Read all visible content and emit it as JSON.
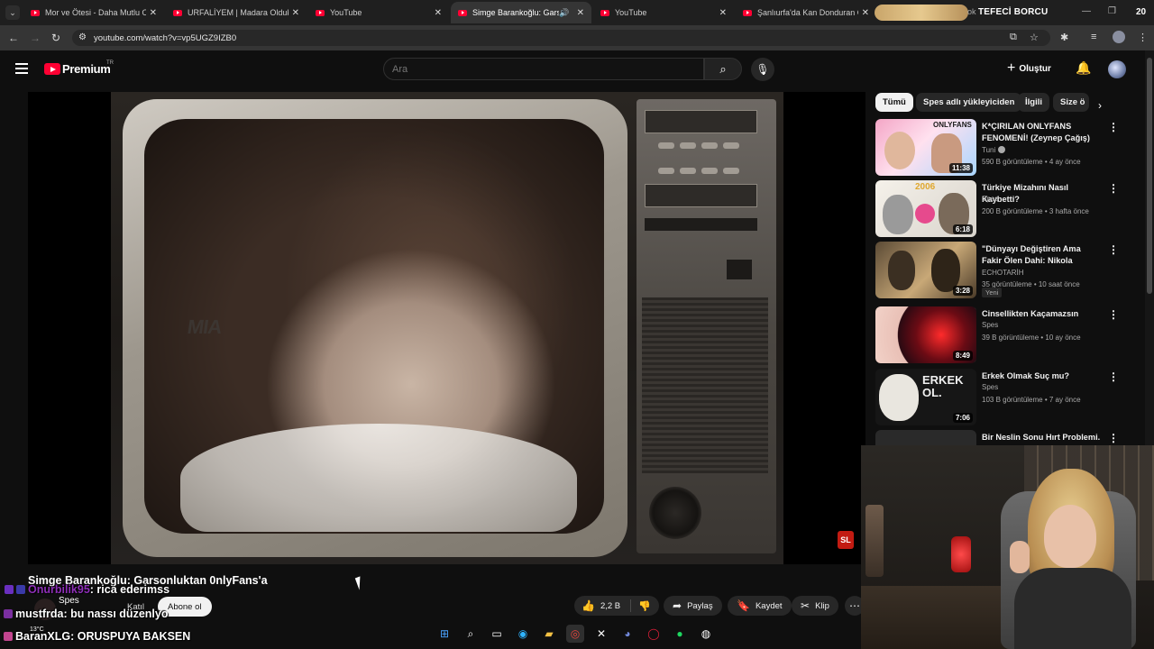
{
  "tabs": [
    {
      "title": "Mor ve Ötesi - Daha Mutlu Ola",
      "active": false
    },
    {
      "title": "URFALİYEM | Madara Olduk #6",
      "active": false
    },
    {
      "title": "YouTube",
      "active": false
    },
    {
      "title": "Simge Barankoğlu: Garsonl",
      "active": true
    },
    {
      "title": "YouTube",
      "active": false
    },
    {
      "title": "Şanlıurfa'da Kan Donduran Ola",
      "active": false
    }
  ],
  "overlay": {
    "title": "TEFECİ BORCU",
    "tab_fragment": "ok",
    "number": "20"
  },
  "address_bar": {
    "url": "youtube.com/watch?v=vp5UGZ9IZB0"
  },
  "masthead": {
    "brand": "Premium",
    "region": "TR",
    "search_placeholder": "Ara",
    "create_label": "Oluştur"
  },
  "video": {
    "title": "Simge Barankoğlu: Garsonluktan 0nlyFans'a",
    "channel": "Spes",
    "join_label": "Katıl",
    "subscribe_label": "Abone ol",
    "sign_text": "MIA"
  },
  "actions": {
    "likes": "2,2 B",
    "share": "Paylaş",
    "save": "Kaydet",
    "clip": "Klip"
  },
  "chat": [
    {
      "user": "Onurbilik95",
      "message": ": rica ederimss"
    },
    {
      "user": "mustfrda",
      "message": ": bu nassı düzenlyo"
    },
    {
      "user": "BaranXLG",
      "message": ": ORUSPUYA BAKSEN"
    }
  ],
  "weather": {
    "temp": "13°C"
  },
  "chips": [
    "Tümü",
    "Spes adlı yükleyiciden",
    "İlgili",
    "Size ö"
  ],
  "recommendations": [
    {
      "title": "K*ÇIRILAN ONLYFANS FENOMENİ! (Zeynep Çağış)",
      "channel": "Tuni",
      "verified": true,
      "meta": "590 B görüntüleme • 4 ay önce",
      "duration": "11:38",
      "badge": ""
    },
    {
      "title": "Türkiye Mizahını Nasıl Kaybetti?",
      "channel": "Spes",
      "verified": false,
      "meta": "200 B görüntüleme • 3 hafta önce",
      "duration": "6:18",
      "badge": ""
    },
    {
      "title": "\"Dünyayı Değiştiren Ama Fakir Ölen Dahi: Nikola Tesla'nın ...",
      "channel": "ECHOTARİH",
      "verified": false,
      "meta": "35 görüntüleme • 10 saat önce",
      "duration": "3:28",
      "badge": "Yeni"
    },
    {
      "title": "Cinsellikten Kaçamazsın",
      "channel": "Spes",
      "verified": false,
      "meta": "39 B görüntüleme • 10 ay önce",
      "duration": "8:49",
      "badge": ""
    },
    {
      "title": "Erkek Olmak Suç mu?",
      "channel": "Spes",
      "verified": false,
      "meta": "103 B görüntüleme • 7 ay önce",
      "duration": "7:06",
      "badge": ""
    },
    {
      "title": "Bir Neslin Sonu Hırt Problemi.",
      "channel": "",
      "verified": false,
      "meta": "",
      "duration": "",
      "badge": ""
    }
  ],
  "thumb_texts": [
    "ONLYFANS",
    "2006",
    "",
    "",
    "ERKEK OL.",
    ""
  ],
  "colors": {
    "youtube_red": "#ff0033",
    "chat_user": "#8e2fb8",
    "background": "#0f0f0f"
  },
  "icons": [
    "hamburger-icon",
    "search-icon",
    "mic-icon",
    "bell-icon",
    "like-icon",
    "dislike-icon",
    "share-icon",
    "save-icon",
    "clip-icon",
    "more-icon"
  ]
}
